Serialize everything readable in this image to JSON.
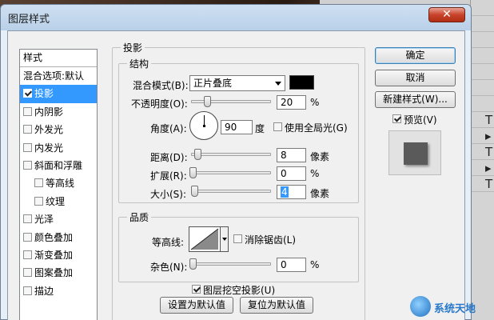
{
  "window": {
    "title": "图层样式",
    "close_label": "✕"
  },
  "style_list": {
    "header": "样式",
    "items": [
      {
        "label": "混合选项:默认",
        "has_checkbox": false,
        "checked": false,
        "selected": false,
        "sub": false
      },
      {
        "label": "投影",
        "has_checkbox": true,
        "checked": true,
        "selected": true,
        "sub": false
      },
      {
        "label": "内阴影",
        "has_checkbox": true,
        "checked": false,
        "selected": false,
        "sub": false
      },
      {
        "label": "外发光",
        "has_checkbox": true,
        "checked": false,
        "selected": false,
        "sub": false
      },
      {
        "label": "内发光",
        "has_checkbox": true,
        "checked": false,
        "selected": false,
        "sub": false
      },
      {
        "label": "斜面和浮雕",
        "has_checkbox": true,
        "checked": false,
        "selected": false,
        "sub": false
      },
      {
        "label": "等高线",
        "has_checkbox": true,
        "checked": false,
        "selected": false,
        "sub": true
      },
      {
        "label": "纹理",
        "has_checkbox": true,
        "checked": false,
        "selected": false,
        "sub": true
      },
      {
        "label": "光泽",
        "has_checkbox": true,
        "checked": false,
        "selected": false,
        "sub": false
      },
      {
        "label": "颜色叠加",
        "has_checkbox": true,
        "checked": false,
        "selected": false,
        "sub": false
      },
      {
        "label": "渐变叠加",
        "has_checkbox": true,
        "checked": false,
        "selected": false,
        "sub": false
      },
      {
        "label": "图案叠加",
        "has_checkbox": true,
        "checked": false,
        "selected": false,
        "sub": false
      },
      {
        "label": "描边",
        "has_checkbox": true,
        "checked": false,
        "selected": false,
        "sub": false
      }
    ]
  },
  "drop_shadow": {
    "section_title": "投影",
    "structure": {
      "title": "结构",
      "blend_mode_label": "混合模式(B):",
      "blend_mode_value": "正片叠底",
      "shadow_color": "#000000",
      "opacity_label": "不透明度(O):",
      "opacity_value": "20",
      "opacity_unit": "%",
      "opacity_fraction": 0.2,
      "angle_label": "角度(A):",
      "angle_value": "90",
      "angle_unit": "度",
      "global_light_label": "使用全局光(G)",
      "global_light_checked": false,
      "distance_label": "距离(D):",
      "distance_value": "8",
      "distance_unit": "像素",
      "spread_label": "扩展(R):",
      "spread_value": "0",
      "spread_unit": "%",
      "size_label": "大小(S):",
      "size_value": "4",
      "size_unit": "像素"
    },
    "quality": {
      "title": "品质",
      "contour_label": "等高线:",
      "anti_alias_label": "消除锯齿(L)",
      "anti_alias_checked": false,
      "noise_label": "杂色(N):",
      "noise_value": "0",
      "noise_unit": "%"
    },
    "knockout_label": "图层挖空投影(U)",
    "knockout_checked": true,
    "set_default_label": "设置为默认值",
    "reset_default_label": "复位为默认值"
  },
  "buttons": {
    "ok": "确定",
    "cancel": "取消",
    "new_style": "新建样式(W)...",
    "preview_label": "预览(V)",
    "preview_checked": true
  },
  "layers_panel": {
    "glyphs": [
      "",
      "",
      "",
      "",
      "",
      "",
      "",
      "T",
      "▸",
      "T",
      "▸",
      "T"
    ]
  },
  "watermark": {
    "text": "系统天地"
  }
}
